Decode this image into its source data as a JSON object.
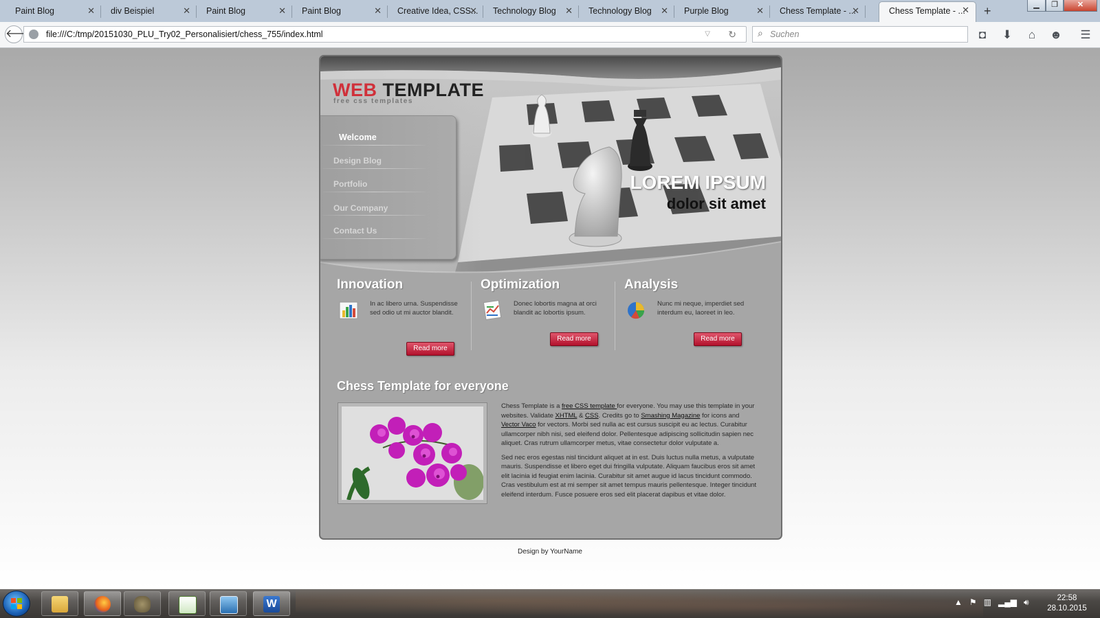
{
  "browser": {
    "tabs": [
      {
        "label": "Paint Blog"
      },
      {
        "label": "div Beispiel"
      },
      {
        "label": "Paint Blog"
      },
      {
        "label": "Paint Blog"
      },
      {
        "label": "Creative Idea, CSS..."
      },
      {
        "label": "Technology Blog"
      },
      {
        "label": "Technology Blog"
      },
      {
        "label": "Purple Blog"
      },
      {
        "label": "Chess Template - ..."
      },
      {
        "label": "Chess Template - ..."
      }
    ],
    "active_tab_index": 9,
    "url": "file:///C:/tmp/20151030_PLU_Try02_Personalisiert/chess_755/index.html",
    "search_placeholder": "Suchen"
  },
  "page": {
    "logo": {
      "word1": "WEB",
      "word2": "TEMPLATE",
      "tagline": "free css templates"
    },
    "hero": {
      "title": "LOREM IPSUM",
      "subtitle": "dolor sit amet"
    },
    "menu": [
      {
        "label": "Welcome",
        "current": true
      },
      {
        "label": "Design Blog"
      },
      {
        "label": "Portfolio"
      },
      {
        "label": "Our Company"
      },
      {
        "label": "Contact Us"
      }
    ],
    "columns": [
      {
        "title": "Innovation",
        "icon": "bar-chart-icon",
        "text": "In ac libero urna. Suspendisse sed odio ut mi auctor blandit.",
        "button": "Read more"
      },
      {
        "title": "Optimization",
        "icon": "document-chart-icon",
        "text": "Donec lobortis magna at orci blandit ac lobortis ipsum.",
        "button": "Read more"
      },
      {
        "title": "Analysis",
        "icon": "pie-chart-icon",
        "text": "Nunc mi neque, imperdiet sed interdum eu, laoreet in leo.",
        "button": "Read more"
      }
    ],
    "section": {
      "title": "Chess Template for everyone",
      "p1": {
        "t1": "Chess Template is a ",
        "link1": "free CSS template ",
        "t2": "for everyone. You may use this template in your websites. Validate ",
        "link2": "XHTML",
        "t3": " & ",
        "link3": "CSS",
        "t4": ". Credits go to ",
        "link4": "Smashing Magazine",
        "t5": " for icons and ",
        "link5": "Vector Vaco",
        "t6": " for vectors. Morbi sed nulla ac est cursus suscipit eu ac lectus. Curabitur ullamcorper nibh nisi, sed eleifend dolor. Pellentesque adipiscing sollicitudin sapien nec aliquet. Cras rutrum ullamcorper metus, vitae consectetur dolor vulputate a."
      },
      "p2": "Sed nec eros egestas nisl tincidunt aliquet at in est. Duis luctus nulla metus, a vulputate mauris. Suspendisse et libero eget dui fringilla vulputate. Aliquam faucibus eros sit amet elit lacinia id feugiat enim lacinia. Curabitur sit amet augue id lacus tincidunt commodo. Cras vestibulum est at mi semper sit amet tempus mauris pellentesque. Integer tincidunt eleifend interdum. Fusce posuere eros sed elit placerat dapibus et vitae dolor."
    },
    "footer": "Design by YourName"
  },
  "taskbar": {
    "apps": [
      "file-explorer-icon",
      "firefox-icon",
      "gimp-icon",
      "spreadsheet-icon",
      "image-viewer-icon",
      "word-icon"
    ],
    "time": "22:58",
    "date": "28.10.2015"
  },
  "colors": {
    "accent_red": "#d0303a",
    "button_red": "#b2112c",
    "panel_gray": "#a6a6a6"
  }
}
